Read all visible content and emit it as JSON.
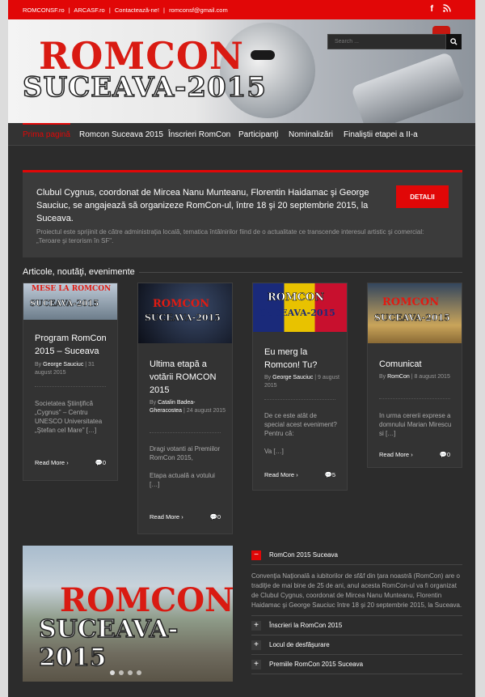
{
  "topbar": {
    "links": [
      "ROMCONSF.ro",
      "|",
      "ARCASF.ro",
      "|",
      "Contactează-ne!",
      "|",
      "romconsf@gmail.com"
    ],
    "social": [
      "f",
      "rss"
    ]
  },
  "banner": {
    "title_line1": "ROMCON",
    "title_line2": "SUCEAVA-2015",
    "search_placeholder": "Search ..."
  },
  "nav": {
    "items": [
      "Prima pagină",
      "Romcon Suceava 2015",
      "Înscrieri RomCon",
      "Participanţi",
      "Nominalizări",
      "Finaliştii etapei a II-a"
    ],
    "active_index": 0
  },
  "tagline": {
    "heading": "Clubul Cygnus, coordonat de Mircea Nanu Munteanu, Florentin Haidamac şi George Sauciuc, se angajează să organizeze RomCon-ul, între 18 şi 20 septembrie 2015, la Suceava.",
    "subtext": "Proiectul este sprijinit de către administraţia locală, tematica întâlnirilor fiind de o actualitate ce transcende interesul artistic şi comercial: „Teroare şi terorism în SF\".",
    "button": "DETALII"
  },
  "section": {
    "title": "Articole, noutăţi, evenimente"
  },
  "posts": [
    {
      "title": "Program RomCon 2015 – Suceava",
      "by": "By",
      "author": "George Sauciuc",
      "date": "31 august 2015",
      "excerpt": "Societatea Ştiinţifică „Cygnus\" – Centru UNESCO Universitatea „Ştefan cel Mare\" […]",
      "more": "Read More",
      "comments": "0"
    },
    {
      "title": "Ultima etapă a votării ROMCON 2015",
      "by": "By",
      "author": "Catalin Badea-Gheracostea",
      "date": "24 august 2015",
      "excerpt": "Dragi votanti ai Premiilor RomCon 2015,\n\nEtapa actuală a votului […]",
      "more": "Read More",
      "comments": "0"
    },
    {
      "title": "Eu merg la Romcon! Tu?",
      "by": "By",
      "author": "George Sauciuc",
      "date": "9 august 2015",
      "excerpt": "De ce este atât de special acest eveniment? Pentru că:\n\nVa […]",
      "more": "Read More",
      "comments": "5"
    },
    {
      "title": "Comunicat",
      "by": "By",
      "author": "RomCon",
      "date": "8 august 2015",
      "excerpt": "In urma cererii exprese a domnului Marian Mirescu si […]",
      "more": "Read More",
      "comments": "0"
    }
  ],
  "thumbs": {
    "post1_top": "MESE LA ROMCON",
    "post1_bottom": "SUCEAVA-2015",
    "post2_top": "ROMCON",
    "post2_bottom": "SUCEAVA-2015",
    "post3_top": "ROMCON",
    "post3_bottom": "SUCEAVA-2015",
    "post4_top": "ROMCON",
    "post4_bottom": "SUCEAVA-2015"
  },
  "slider": {
    "line1": "ROMCON",
    "line2": "SUCEAVA-2015"
  },
  "accordion": {
    "open_title": "RomCon 2015 Suceava",
    "open_body": "Convenţia Naţională a iubitorilor de sf&f din ţara noastră (RomCon) are o tradiţie de mai bine de 25 de ani, anul acesta RomCon-ul va fi organizat de Clubul Cygnus, coordonat de Mircea Nanu Munteanu, Florentin Haidamac şi George Sauciuc între 18 şi 20 septembrie 2015, la Suceava.",
    "collapsed": [
      "Înscrieri la RomCon 2015",
      "Locul de desfăşurare",
      "Premiile RomCon 2015 Suceava"
    ],
    "open_symbol": "−",
    "closed_symbol": "+"
  },
  "colors": {
    "accent": "#e10707",
    "background": "#2c2c2c",
    "card": "#333333"
  }
}
